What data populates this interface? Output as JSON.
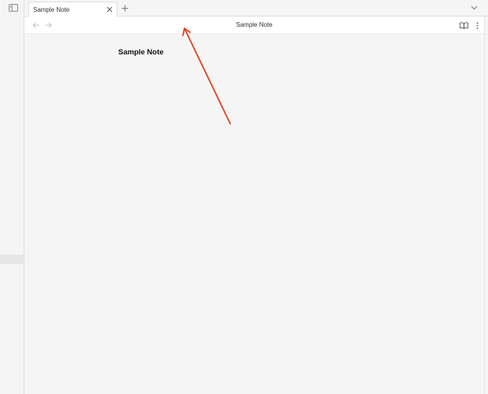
{
  "ribbon": {
    "toggle_icon": "sidebar-left-icon"
  },
  "tabs": [
    {
      "title": "Sample Note",
      "active": true,
      "close_icon": "close-icon"
    }
  ],
  "tabstrip": {
    "new_tab_icon": "plus-icon",
    "tab_list_icon": "chevron-down-icon"
  },
  "navbar": {
    "back_icon": "arrow-left-icon",
    "forward_icon": "arrow-right-icon",
    "title": "Sample Note",
    "reading_view_icon": "book-open-icon",
    "more_options_icon": "more-vertical-icon"
  },
  "note": {
    "heading": "Sample Note"
  },
  "colors": {
    "annotation_arrow": "#d9441f",
    "background": "#f5f5f5",
    "surface": "#ffffff",
    "border": "#e0e0e0",
    "icon": "#8a8a8a"
  }
}
